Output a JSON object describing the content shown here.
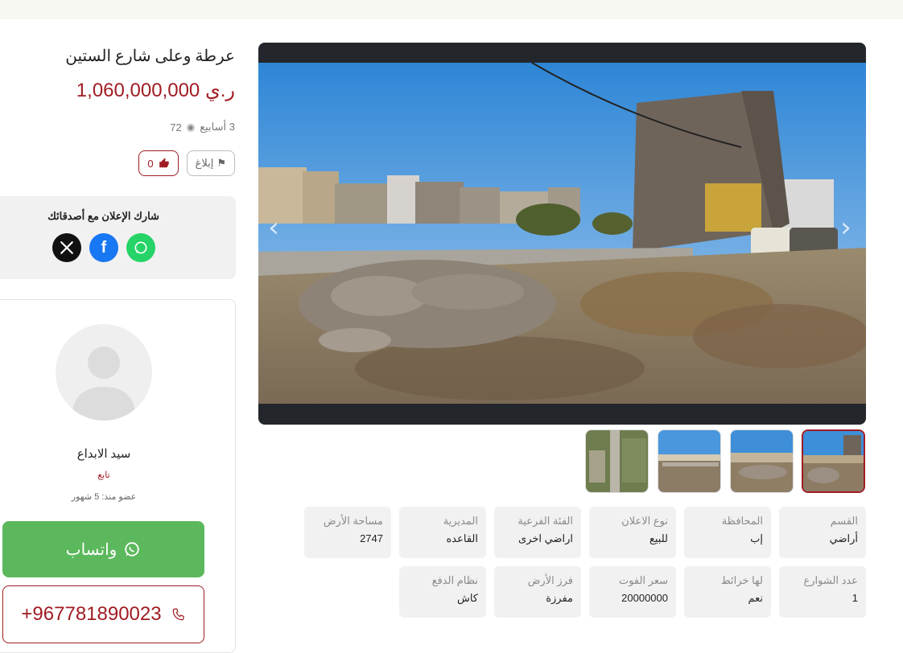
{
  "listing": {
    "title": "عرطة وعلى شارع الستين",
    "price": "1,060,000,000 ر.ي",
    "posted": "3 أسابيع",
    "views": "72",
    "report_label": "إبلاغ",
    "likes": "0"
  },
  "share": {
    "title": "شارك الإعلان مع أصدقائك",
    "networks": [
      "x-icon",
      "facebook-icon",
      "whatsapp-icon"
    ]
  },
  "seller": {
    "name": "سيد الابداع",
    "role": "تابع",
    "member_since": "عضو منذ: 5 شهور",
    "whatsapp_label": "واتساب",
    "phone": "+967781890023"
  },
  "specs": [
    {
      "label": "القسم",
      "value": "أراضي"
    },
    {
      "label": "المحافظة",
      "value": "إب"
    },
    {
      "label": "نوع الاعلان",
      "value": "للبيع"
    },
    {
      "label": "الفئة الفرعية",
      "value": "اراضي اخرى"
    },
    {
      "label": "المديرية",
      "value": "القاعده"
    },
    {
      "label": "مساحة الأرض",
      "value": "2747"
    },
    {
      "label": "عدد الشوارع",
      "value": "1"
    },
    {
      "label": "لها خرائط",
      "value": "نعم"
    },
    {
      "label": "سعر الفوت",
      "value": "20000000"
    },
    {
      "label": "فرز الأرض",
      "value": "مفرزة"
    },
    {
      "label": "نظام الدفع",
      "value": "كاش"
    }
  ],
  "gallery": {
    "active_index": 0,
    "count": 4
  },
  "colors": {
    "accent": "#a01c23",
    "whatsapp": "#5cb85c",
    "card_bg": "#f1f1f1"
  }
}
